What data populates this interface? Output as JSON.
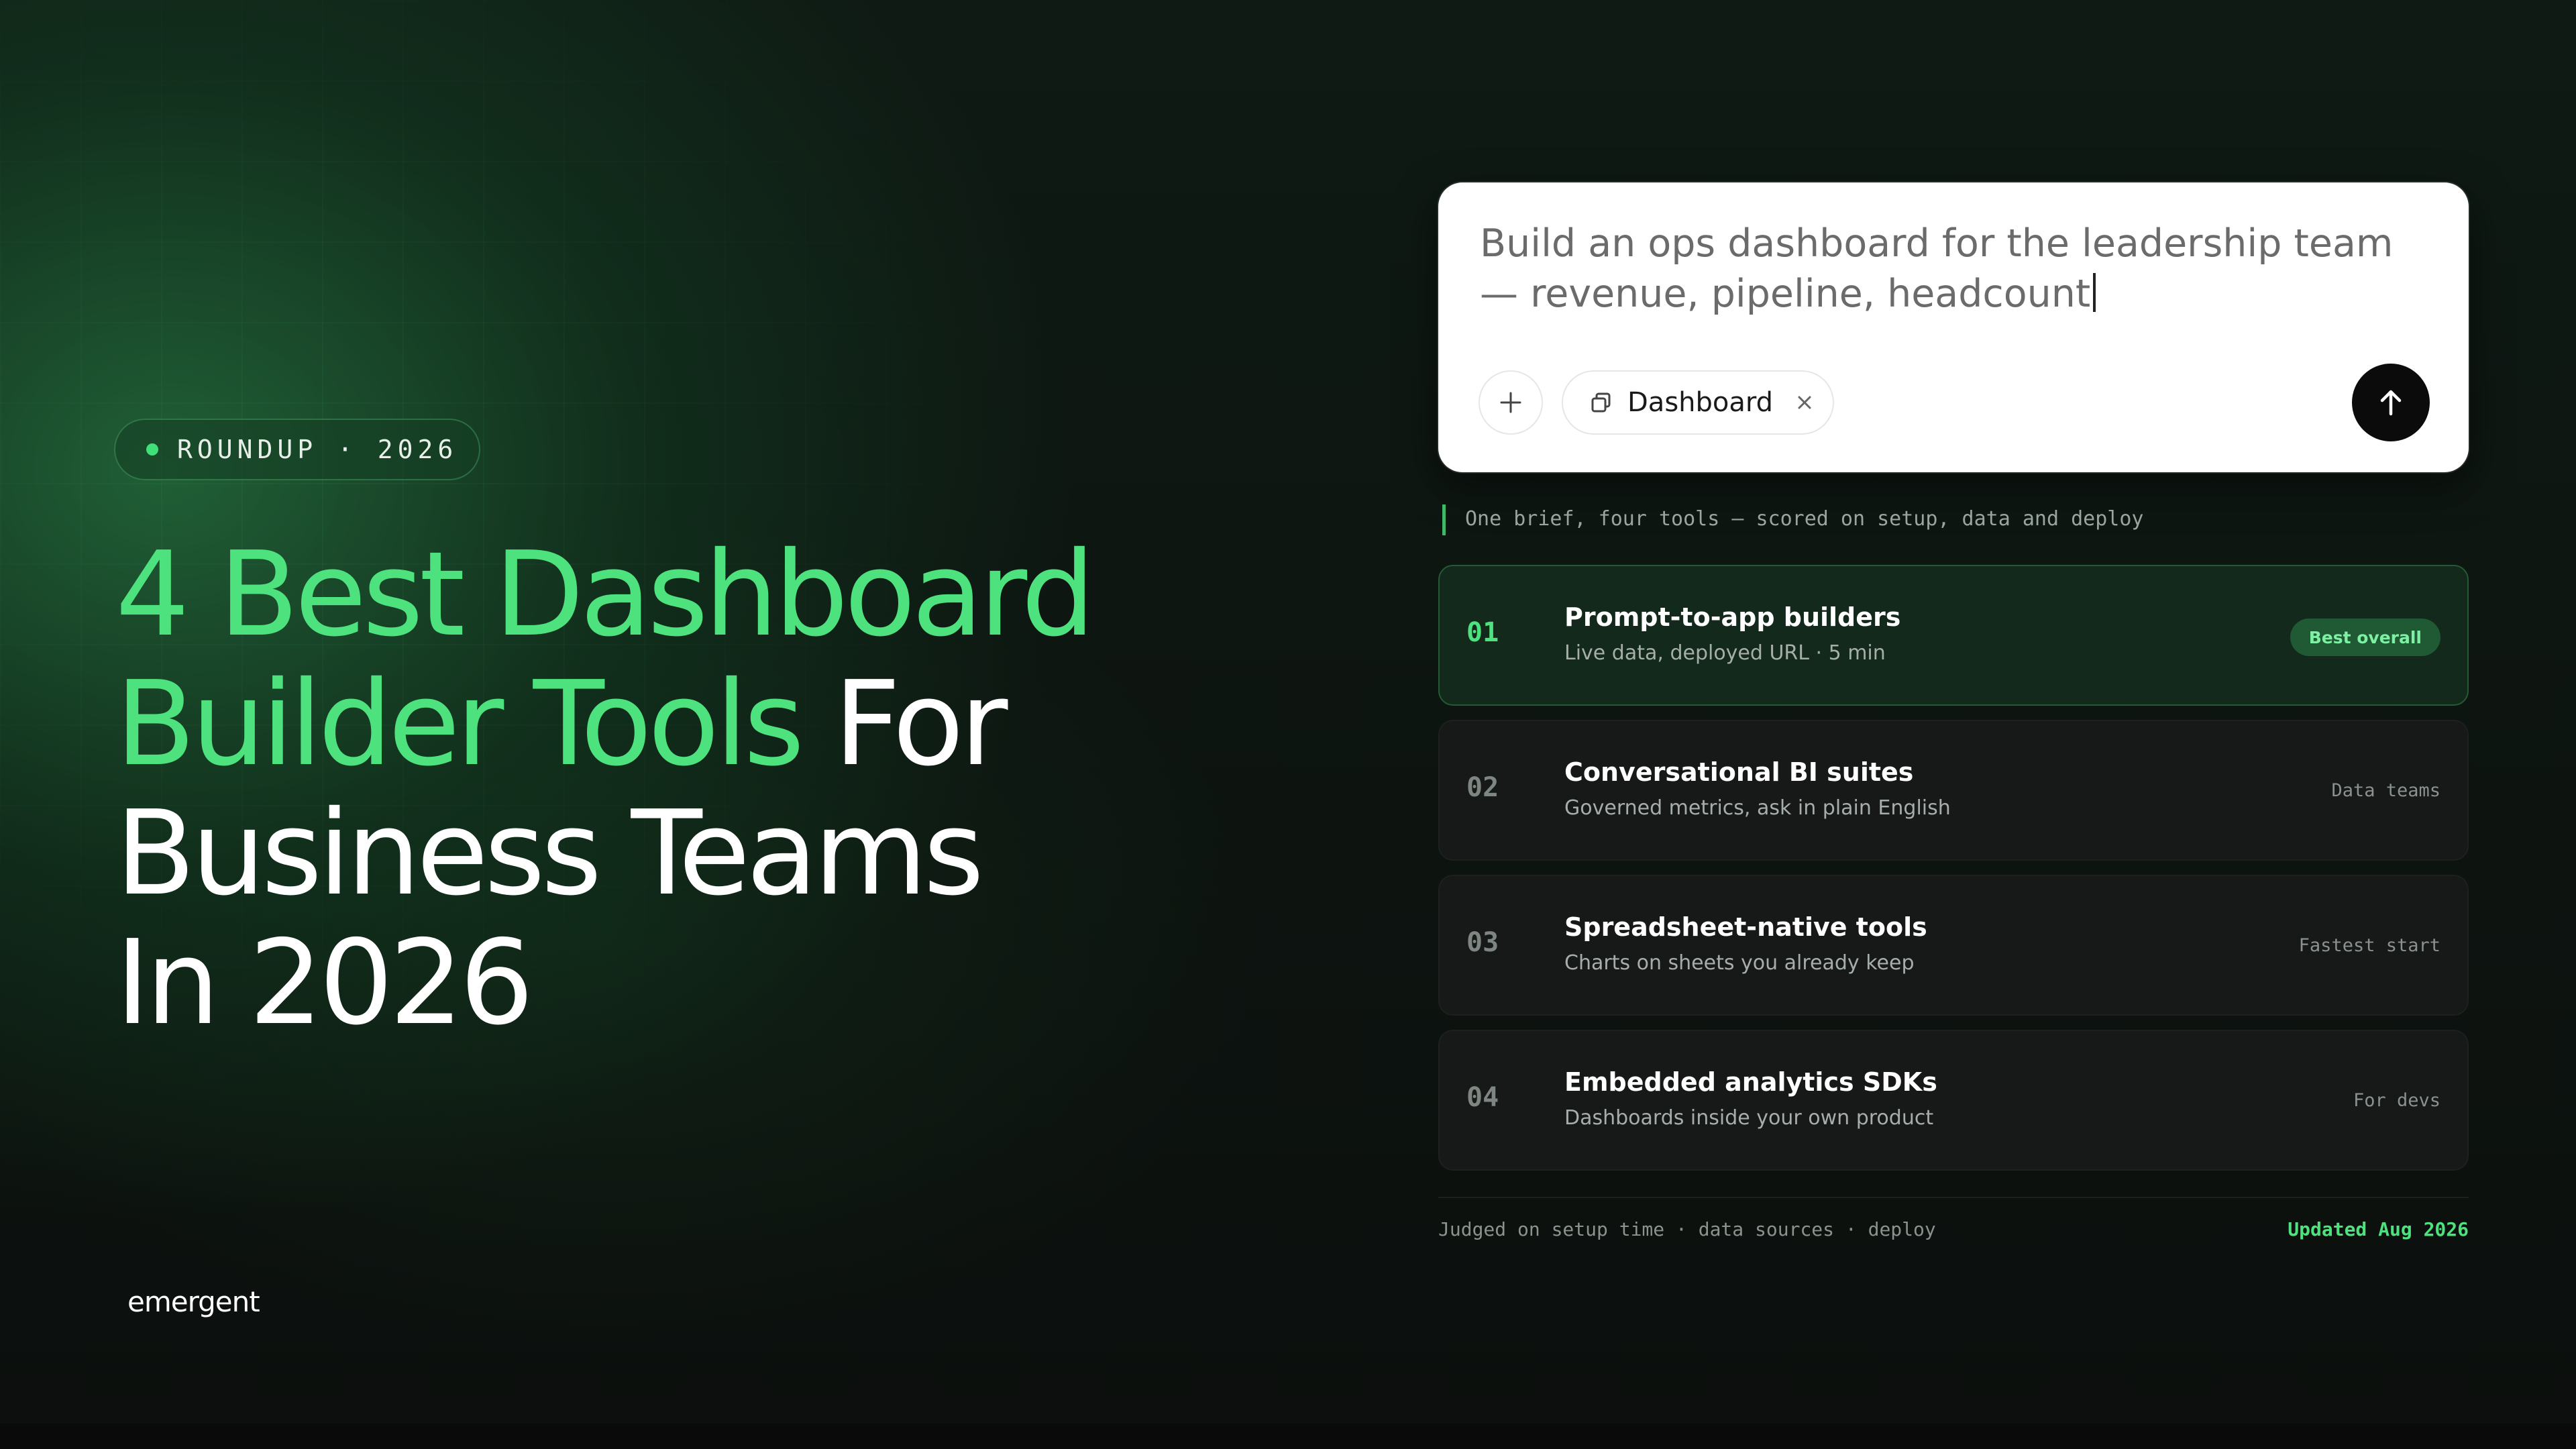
{
  "badge": {
    "label": "ROUNDUP · 2026"
  },
  "headline": {
    "line1": "4 Best Dashboard",
    "line2_green": "Builder Tools",
    "line2_white": " For",
    "line3": "Business Teams",
    "line4": "In 2026"
  },
  "brand": {
    "logo": "emergent"
  },
  "prompt": {
    "text": "Build an ops dashboard for the leadership team — revenue, pipeline, headcount",
    "chip_label": "Dashboard"
  },
  "caption": "One brief, four tools — scored on setup, data and deploy",
  "tools": [
    {
      "num": "01",
      "title": "Prompt-to-app builders",
      "subtitle": "Live data, deployed URL · 5 min",
      "tag": "Best overall"
    },
    {
      "num": "02",
      "title": "Conversational BI suites",
      "subtitle": "Governed metrics, ask in plain English",
      "tag": "Data teams"
    },
    {
      "num": "03",
      "title": "Spreadsheet-native tools",
      "subtitle": "Charts on sheets you already keep",
      "tag": "Fastest start"
    },
    {
      "num": "04",
      "title": "Embedded analytics SDKs",
      "subtitle": "Dashboards inside your own product",
      "tag": "For devs"
    }
  ],
  "footer": {
    "left": "Judged on setup time · data sources · deploy",
    "right": "Updated Aug 2026"
  },
  "colors": {
    "accent": "#4ee27e",
    "background": "#0d0f0e",
    "card": "#ffffff"
  },
  "icons": {
    "plus": "plus-icon",
    "chip": "copy-icon",
    "close": "close-icon",
    "send": "arrow-up-icon"
  }
}
